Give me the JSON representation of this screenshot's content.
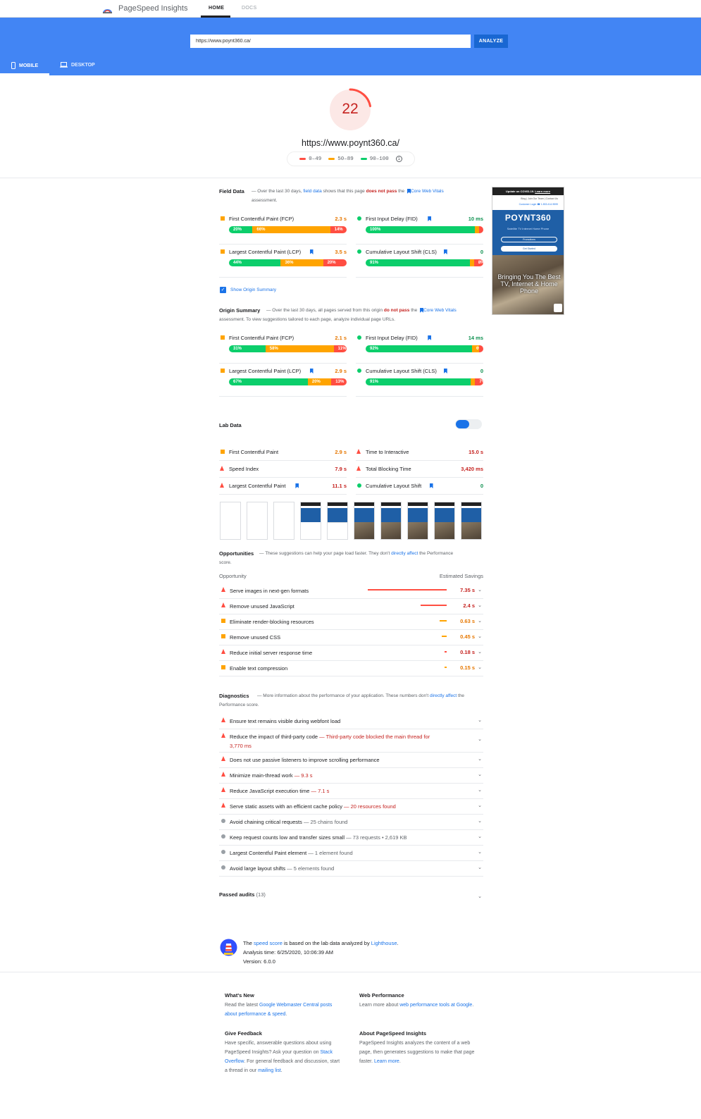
{
  "app": {
    "title": "PageSpeed Insights"
  },
  "nav": {
    "home": "HOME",
    "docs": "DOCS"
  },
  "search": {
    "url": "https://www.poynt360.ca/",
    "analyze": "ANALYZE"
  },
  "device_tabs": {
    "mobile": "MOBILE",
    "desktop": "DESKTOP"
  },
  "score": {
    "value": "22",
    "url": "https://www.poynt360.ca/",
    "fraction": 0.22,
    "legend": {
      "low": "0–49",
      "mid": "50–89",
      "high": "90–100"
    }
  },
  "colors": {
    "fail": "#ff4e42",
    "average": "#ffa400",
    "pass": "#0cce6b",
    "link": "#1a73e8",
    "hero": "#4285f4"
  },
  "field": {
    "title": "Field Data",
    "desc_a": "— Over the last 30 days, ",
    "desc_link": "field data",
    "desc_b": " shows that this page ",
    "desc_fail": "does not pass",
    "desc_c": " the ",
    "desc_cwv": "Core Web Vitals",
    "desc_d": " assessment.",
    "metrics": [
      {
        "name": "First Contentful Paint (FCP)",
        "value": "2.3 s",
        "dist": [
          "20%",
          "66%",
          "14%"
        ],
        "fracs": [
          20,
          66,
          14
        ]
      },
      {
        "name": "First Input Delay (FID)",
        "value": "10 ms",
        "dist": [
          "100%",
          "",
          ""
        ],
        "fracs": [
          100,
          0,
          0
        ]
      },
      {
        "name": "Largest Contentful Paint (LCP)",
        "value": "3.5 s",
        "dist": [
          "44%",
          "36%",
          "20%"
        ],
        "fracs": [
          44,
          36,
          20
        ]
      },
      {
        "name": "Cumulative Layout Shift (CLS)",
        "value": "0",
        "dist": [
          "91%",
          "1%",
          "8%"
        ],
        "fracs": [
          91,
          1,
          8
        ]
      }
    ]
  },
  "origin_toggle": "Show Origin Summary",
  "origin": {
    "title": "Origin Summary",
    "desc_a": "— Over the last 30 days, all pages served from this origin ",
    "desc_fail": "do not pass",
    "desc_b": " the ",
    "desc_cwv_1": "Core",
    "desc_cwv_2": "Web Vitals",
    "desc_c": " assessment. To view suggestions tailored to each page, analyze individual page URLs.",
    "metrics": [
      {
        "name": "First Contentful Paint (FCP)",
        "value": "2.1 s",
        "dist": [
          "31%",
          "58%",
          "11%"
        ],
        "fracs": [
          31,
          58,
          11
        ]
      },
      {
        "name": "First Input Delay (FID)",
        "value": "14 ms",
        "dist": [
          "92%",
          "6%",
          "1%"
        ],
        "fracs": [
          92,
          6,
          2
        ]
      },
      {
        "name": "Largest Contentful Paint (LCP)",
        "value": "2.9 s",
        "dist": [
          "67%",
          "20%",
          "13%"
        ],
        "fracs": [
          67,
          20,
          13
        ]
      },
      {
        "name": "Cumulative Layout Shift (CLS)",
        "value": "0",
        "dist": [
          "91%",
          "2%",
          "7%"
        ],
        "fracs": [
          91,
          2,
          7
        ]
      }
    ]
  },
  "preview": {
    "covid": "Update on COVID-19.",
    "covid_link": "Learn more",
    "links": "Blog   |   Join Our Team   |   Contact Us",
    "login": "Customer Login",
    "phone": "1.833.414.9599",
    "brand": "POYNT360",
    "menu": "Satellite TV    Internet    Home Phone",
    "btn1": "Promotions",
    "btn2": "Get Started",
    "headline": "Bringing You The Best TV, Internet & Home Phone"
  },
  "lab": {
    "title": "Lab Data",
    "metrics": [
      {
        "name": "First Contentful Paint",
        "value": "2.9 s"
      },
      {
        "name": "Time to Interactive",
        "value": "15.0 s"
      },
      {
        "name": "Speed Index",
        "value": "7.9 s"
      },
      {
        "name": "Total Blocking Time",
        "value": "3,420 ms"
      },
      {
        "name": "Largest Contentful Paint",
        "value": "11.1 s"
      },
      {
        "name": "Cumulative Layout Shift",
        "value": "0"
      }
    ]
  },
  "opportunities": {
    "title": "Opportunities",
    "desc_a": "— These suggestions can help your page load faster. They don't ",
    "desc_link": "directly affect",
    "desc_b": " the Performance score.",
    "col_left": "Opportunity",
    "col_right": "Estimated Savings",
    "items": [
      {
        "name": "Serve images in next-gen formats",
        "value": "7.35 s",
        "frac": 1.0
      },
      {
        "name": "Remove unused JavaScript",
        "value": "2.4 s",
        "frac": 0.33
      },
      {
        "name": "Eliminate render-blocking resources",
        "value": "0.63 s",
        "frac": 0.09
      },
      {
        "name": "Remove unused CSS",
        "value": "0.45 s",
        "frac": 0.06
      },
      {
        "name": "Reduce initial server response time",
        "value": "0.18 s",
        "frac": 0.025
      },
      {
        "name": "Enable text compression",
        "value": "0.15 s",
        "frac": 0.02
      }
    ]
  },
  "diagnostics": {
    "title": "Diagnostics",
    "desc_a": "— More information about the performance of your application. These numbers don't ",
    "desc_link_1": "directly",
    "desc_link_2": "affect",
    "desc_b": " the Performance score.",
    "items": [
      {
        "name": "Ensure text remains visible during webfont load",
        "detail": ""
      },
      {
        "name": "Reduce the impact of third-party code",
        "detail": "— Third-party code blocked the main thread for",
        "detail2": "3,770 ms"
      },
      {
        "name": "Does not use passive listeners to improve scrolling performance",
        "detail": ""
      },
      {
        "name": "Minimize main-thread work",
        "detail": "— 9.3 s"
      },
      {
        "name": "Reduce JavaScript execution time",
        "detail": "— 7.1 s"
      },
      {
        "name": "Serve static assets with an efficient cache policy",
        "detail": "— 20 resources found"
      },
      {
        "name": "Avoid chaining critical requests",
        "detail": "— 25 chains found"
      },
      {
        "name": "Keep request counts low and transfer sizes small",
        "detail": "— 73 requests • 2,619 KB"
      },
      {
        "name": "Largest Contentful Paint element",
        "detail": "— 1 element found"
      },
      {
        "name": "Avoid large layout shifts",
        "detail": "— 5 elements found"
      }
    ]
  },
  "passed": {
    "label": "Passed audits",
    "count": "(13)"
  },
  "meta": {
    "line1_a": "The ",
    "line1_link": "speed score",
    "line1_b": " is based on the lab data analyzed by ",
    "line1_link2": "Lighthouse",
    "line1_c": ".",
    "line2": "Analysis time: 6/25/2020, 10:06:39 AM",
    "line3": "Version: 6.0.0"
  },
  "footer": {
    "whats_new": {
      "title": "What's New",
      "a": "Read the latest ",
      "link": "Google Webmaster Central posts about performance & speed",
      "b": "."
    },
    "web_perf": {
      "title": "Web Performance",
      "a": "Learn more about ",
      "link": "web performance tools at Google",
      "b": "."
    },
    "feedback": {
      "title": "Give Feedback",
      "a": "Have specific, answerable questions about using PageSpeed Insights? Ask your question on ",
      "link": "Stack Overflow",
      "b": ". For general feedback and discussion, start a thread in our ",
      "link2": "mailing list",
      "c": "."
    },
    "about": {
      "title": "About PageSpeed Insights",
      "a": "PageSpeed Insights analyzes the content of a web page, then generates suggestions to make that page faster. ",
      "link": "Learn more",
      "b": "."
    }
  }
}
